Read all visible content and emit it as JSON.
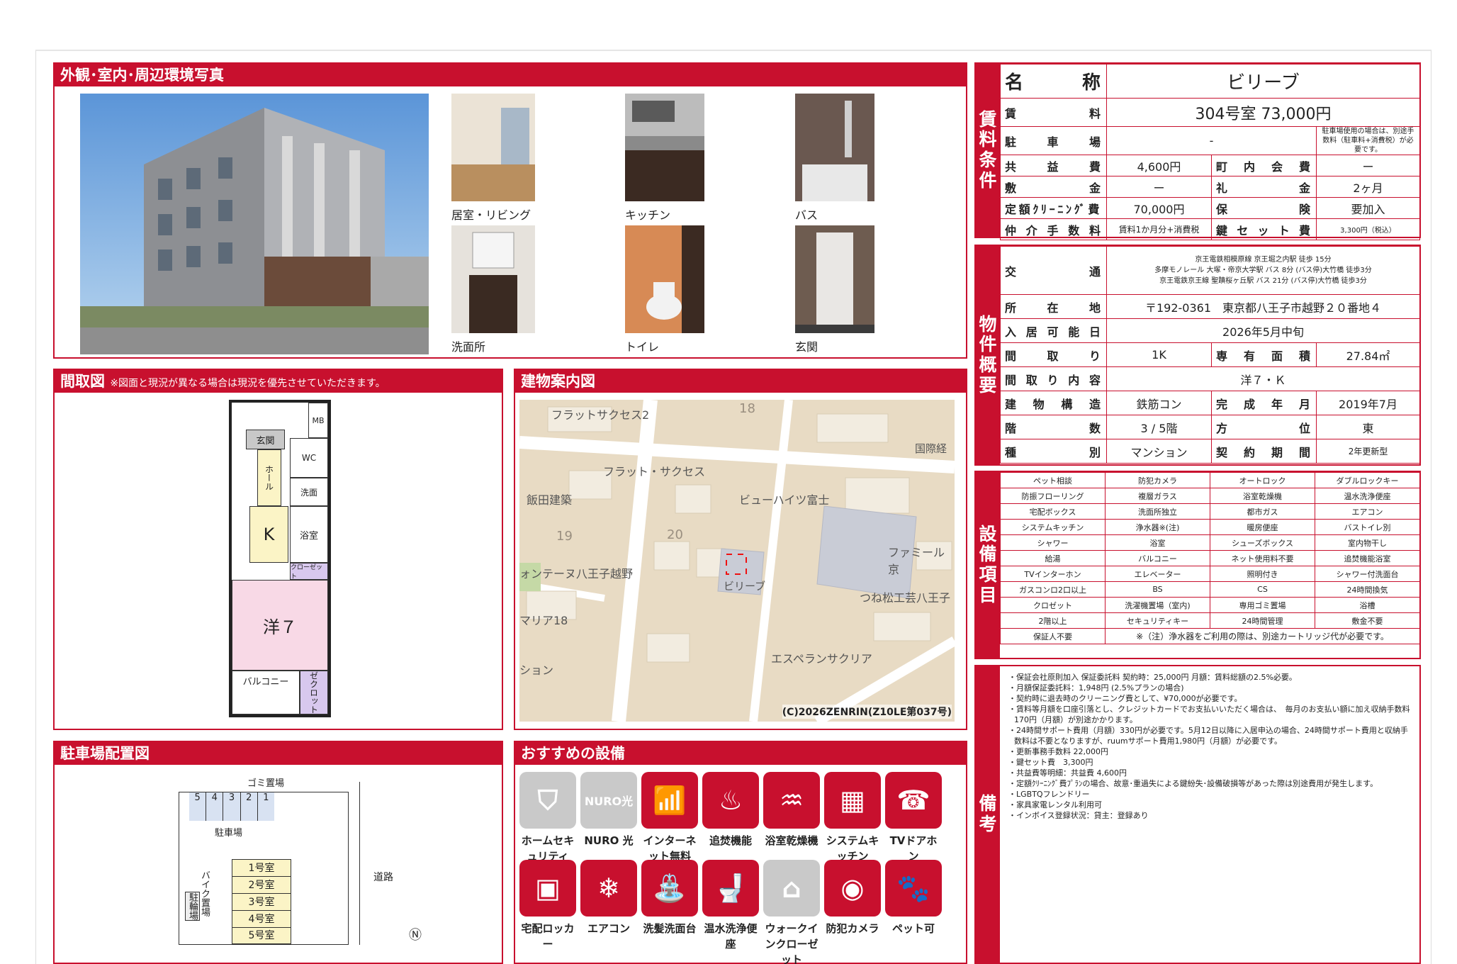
{
  "photos": {
    "title": "外観･室内･周辺環境写真",
    "captions": [
      "居室・リビング",
      "キッチン",
      "バス",
      "洗面所",
      "トイレ",
      "玄関"
    ]
  },
  "floorplan": {
    "title": "間取図",
    "note": "※図面と現況が異なる場合は現況を優先させていただきます。",
    "rooms": {
      "mb": "MB",
      "genkan": "玄関",
      "wc": "WC",
      "hall": "ホール",
      "k": "K",
      "sen": "洗面",
      "bath": "浴室",
      "closet1": "クローゼット",
      "western": "洋７",
      "balcony": "バルコニー",
      "closet2": "ゼクロット"
    }
  },
  "buildingmap": {
    "title": "建物案内図",
    "labels": [
      "フラットサクセス2",
      "18",
      "フラット・サクセス",
      "飯田建築",
      "ビューハイツ富士",
      "国際経",
      "19",
      "20",
      "ファミール京",
      "ォンテーヌ八王子越野",
      "ビリーブ",
      "つね松工芸八王子",
      "マリア18",
      "ション",
      "エスペランサクリア"
    ],
    "copyright": "(C)2026ZENRIN(Z10LE第037号)"
  },
  "parking": {
    "title": "駐車場配置図",
    "slots": [
      "5",
      "4",
      "3",
      "2",
      "1"
    ],
    "garbage": "ゴミ置場",
    "lot": "駐車場",
    "bike": "バイク置場",
    "cycle": "駐輪場",
    "rooms": [
      "1号室",
      "2号室",
      "3号室",
      "4号室",
      "5号室"
    ],
    "road": "道路"
  },
  "facilities": {
    "title": "おすすめの設備",
    "items": [
      {
        "label": "ホームセキュリティ",
        "icon": "shield-icon",
        "active": false
      },
      {
        "label": "NURO 光",
        "icon": "nuro-icon",
        "active": false
      },
      {
        "label": "インターネット無料",
        "icon": "wifi-icon",
        "active": true
      },
      {
        "label": "追焚機能",
        "icon": "bathtub-icon",
        "active": true
      },
      {
        "label": "浴室乾燥機",
        "icon": "bath-dryer-icon",
        "active": true
      },
      {
        "label": "システムキッチン",
        "icon": "kitchen-icon",
        "active": true
      },
      {
        "label": "TVドアホン",
        "icon": "doorphone-icon",
        "active": true
      },
      {
        "label": "宅配ロッカー",
        "icon": "delivery-locker-icon",
        "active": true
      },
      {
        "label": "エアコン",
        "icon": "aircon-icon",
        "active": true
      },
      {
        "label": "洗髪洗面台",
        "icon": "washbasin-icon",
        "active": true
      },
      {
        "label": "温水洗浄便座",
        "icon": "toilet-icon",
        "active": true
      },
      {
        "label": "ウォークインクローゼット",
        "icon": "closet-icon",
        "active": false
      },
      {
        "label": "防犯カメラ",
        "icon": "camera-icon",
        "active": true
      },
      {
        "label": "ペット可",
        "icon": "paw-icon",
        "active": true
      }
    ]
  },
  "rent": {
    "vlabel": "賃料条件",
    "name_k": "名　　称",
    "name_v": "ビリーブ",
    "rent_k": "賃料",
    "rent_v": "304号室 73,000円",
    "park_k": "駐車場",
    "park_v": "-",
    "park_note": "駐車場使用の場合は、別途手数料（駐車料+消費税）が必要です。",
    "kyoeki_k": "共益費",
    "kyoeki_v": "4,600円",
    "chonai_k": "町内会費",
    "chonai_v": "ー",
    "shiki_k": "敷金",
    "shiki_v": "ー",
    "rei_k": "礼金",
    "rei_v": "2ヶ月",
    "clean_k": "定額ｸﾘｰﾆﾝｸﾞ費",
    "clean_v": "70,000円",
    "hoken_k": "保険",
    "hoken_v": "要加入",
    "chukai_k": "仲介手数料",
    "chukai_v": "賃料1か月分+消費税",
    "key_k": "鍵セット費",
    "key_v": "3,300円（税込）"
  },
  "property": {
    "vlabel": "物件概要",
    "kotsu_k": "交通",
    "kotsu_v": [
      "京王電鉄相模原線 京王堀之内駅 徒歩 15分",
      "多摩モノレール 大塚・帝京大学駅 バス 8分 (バス停)大竹橋 徒歩3分",
      "京王電鉄京王線 聖蹟桜ヶ丘駅 バス 21分 (バス停)大竹橋 徒歩3分"
    ],
    "addr_k": "所在地",
    "addr_v": "〒192-0361　東京都八王子市越野２０番地４",
    "nyukyo_k": "入居可能日",
    "nyukyo_v": "2026年5月中旬",
    "madori_k": "間取り",
    "madori_v": "1K",
    "area_k": "専有面積",
    "area_v": "27.84㎡",
    "naiyo_k": "間取り内容",
    "naiyo_v": "洋７・Ｋ",
    "kozo_k": "建物構造",
    "kozo_v": "鉄筋コン",
    "kansei_k": "完成年月",
    "kansei_v": "2019年7月",
    "kaisu_k": "階数",
    "kaisu_v": "3 / 5階",
    "hoi_k": "方位",
    "hoi_v": "東",
    "shubetsu_k": "種別",
    "shubetsu_v": "マンション",
    "keiyaku_k": "契約期間",
    "keiyaku_v": "2年更新型"
  },
  "equipment": {
    "vlabel": "設備項目",
    "rows": [
      [
        "ペット相談",
        "防犯カメラ",
        "オートロック",
        "ダブルロックキー"
      ],
      [
        "防振フローリング",
        "複層ガラス",
        "浴室乾燥機",
        "温水洗浄便座"
      ],
      [
        "宅配ボックス",
        "洗面所独立",
        "都市ガス",
        "エアコン"
      ],
      [
        "システムキッチン",
        "浄水器※(注)",
        "暖房便座",
        "バストイレ別"
      ],
      [
        "シャワー",
        "浴室",
        "シューズボックス",
        "室内物干し"
      ],
      [
        "給湯",
        "バルコニー",
        "ネット使用料不要",
        "追焚機能浴室"
      ],
      [
        "TVインターホン",
        "エレベーター",
        "照明付き",
        "シャワー付洗面台"
      ],
      [
        "ガスコンロ2口以上",
        "BS",
        "CS",
        "24時間換気"
      ],
      [
        "クロゼット",
        "洗濯機置場（室内)",
        "専用ゴミ置場",
        "浴槽"
      ],
      [
        "2階以上",
        "セキュリティキー",
        "24時間管理",
        "敷金不要"
      ]
    ],
    "last_label": "保証人不要",
    "last_note": "※（注）浄水器をご利用の際は、別途カートリッジ代が必要です。"
  },
  "remarks": {
    "vlabel": "備考",
    "lines": [
      "・保証会社原則加入 保証委託料 契約時：25,000円 月額：賃料総額の2.5%必要。",
      "・月額保証委託料：1,948円 (2.5%プランの場合)",
      "・契約時に退去時のクリーニング費として、¥70,000が必要です。",
      "・賃料等月額を口座引落とし、クレジットカードでお支払いいただく場合は、　毎月のお支払い額に加え収納手数料 170円（月額）が別途かかります。",
      "・24時間サポート費用（月額）330円が必要です。5月12日以降に入居申込の場合、24時間サポート費用と収納手数料は不要となりますが、ruumサポート費用1,980円（月額）が必要です。",
      "・更新事務手数料 22,000円",
      "・鍵セット費　3,300円",
      "・共益費等明細：共益費 4,600円",
      "・定額ｸﾘｰﾆﾝｸﾞ費ﾌﾟﾗﾝの場合、故意･重過失による鍵紛失･設備破損等があった際は別途費用が発生します。",
      "・LGBTQフレンドリー",
      "・家具家電レンタル利用可",
      "・インボイス登録状況：貸主：登録あり"
    ]
  },
  "colors": {
    "accent": "#c8102e"
  }
}
